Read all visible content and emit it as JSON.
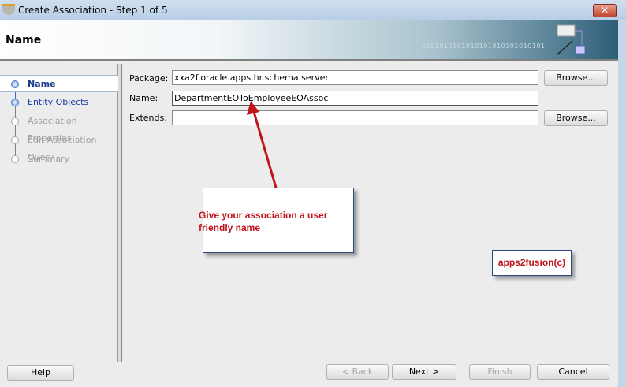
{
  "window": {
    "title": "Create Association - Step 1 of 5",
    "close_label": "✕"
  },
  "header": {
    "title": "Name",
    "binary_text": "0101010101010101010101010101"
  },
  "steps": [
    {
      "label": "Name",
      "state": "current"
    },
    {
      "label": "Entity Objects",
      "state": "link"
    },
    {
      "label": "Association Properties",
      "state": "disabled"
    },
    {
      "label": "Edit Association Query",
      "state": "disabled"
    },
    {
      "label": "Summary",
      "state": "disabled"
    }
  ],
  "form": {
    "package_label": "Package:",
    "package_value": "xxa2f.oracle.apps.hr.schema.server",
    "name_label": "Name:",
    "name_value": "DepartmentEOToEmployeeEOAssoc",
    "extends_label": "Extends:",
    "extends_value": "",
    "browse_label": "Browse..."
  },
  "annotations": {
    "callout": "Give your association a user friendly name",
    "watermark": "apps2fusion(c)",
    "color": "#c0141c"
  },
  "footer": {
    "help": "Help",
    "back": "< Back",
    "next": "Next >",
    "finish": "Finish",
    "cancel": "Cancel"
  }
}
